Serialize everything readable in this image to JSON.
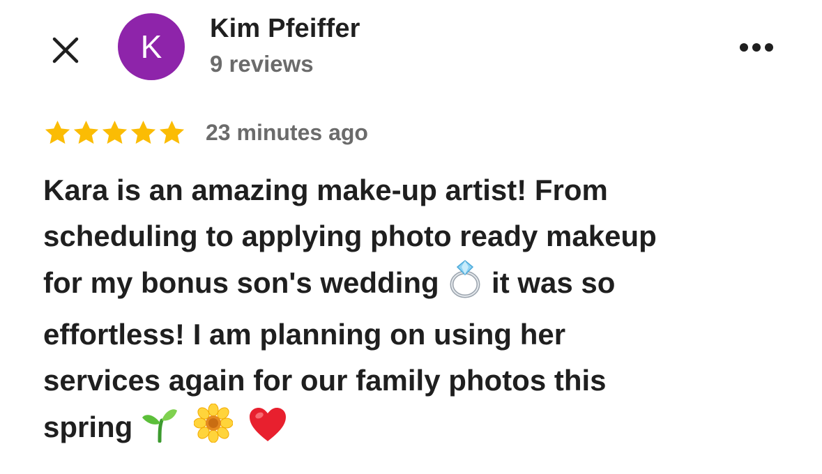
{
  "header": {
    "close_icon": "close-icon",
    "avatar_letter": "K",
    "avatar_color": "#8e24aa",
    "reviewer_name": "Kim Pfeiffer",
    "review_count": "9 reviews",
    "more_icon": "more-horizontal-icon"
  },
  "review": {
    "rating": 5,
    "max_rating": 5,
    "star_color": "#fbbc04",
    "timestamp": "23 minutes ago",
    "lines": [
      {
        "text": "Kara is an amazing make-up artist! From"
      },
      {
        "text": "scheduling to applying photo ready makeup"
      },
      {
        "text_before": "for my bonus son's wedding ",
        "emoji": "ring-emoji",
        "text_after": " it was so"
      },
      {
        "text": "effortless! I am planning on using her"
      },
      {
        "text": "services again for our family photos this"
      },
      {
        "text_before": "spring ",
        "emojis": [
          "seedling-emoji",
          "sunflower-emoji",
          "red-heart-emoji"
        ]
      }
    ]
  }
}
